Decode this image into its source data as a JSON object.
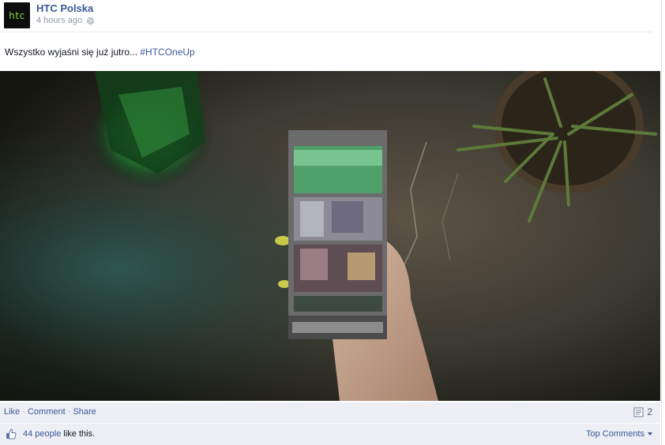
{
  "post": {
    "page_name": "HTC Polska",
    "avatar_text": "htc",
    "timestamp": "4 hours ago",
    "privacy_icon": "globe-icon",
    "message_text": "Wszystko wyjaśni się już jutro... ",
    "hashtag": "#HTCOneUp"
  },
  "actions": {
    "like": "Like",
    "comment": "Comment",
    "share": "Share",
    "separator": " · ",
    "comment_count": "2"
  },
  "likes": {
    "people_link": "44 people",
    "suffix": " like this.",
    "top_comments": "Top Comments"
  },
  "colors": {
    "link": "#3b5998",
    "meta": "#9197a3",
    "bar_background": "#edeff4",
    "brand_green": "#8ad43f"
  }
}
